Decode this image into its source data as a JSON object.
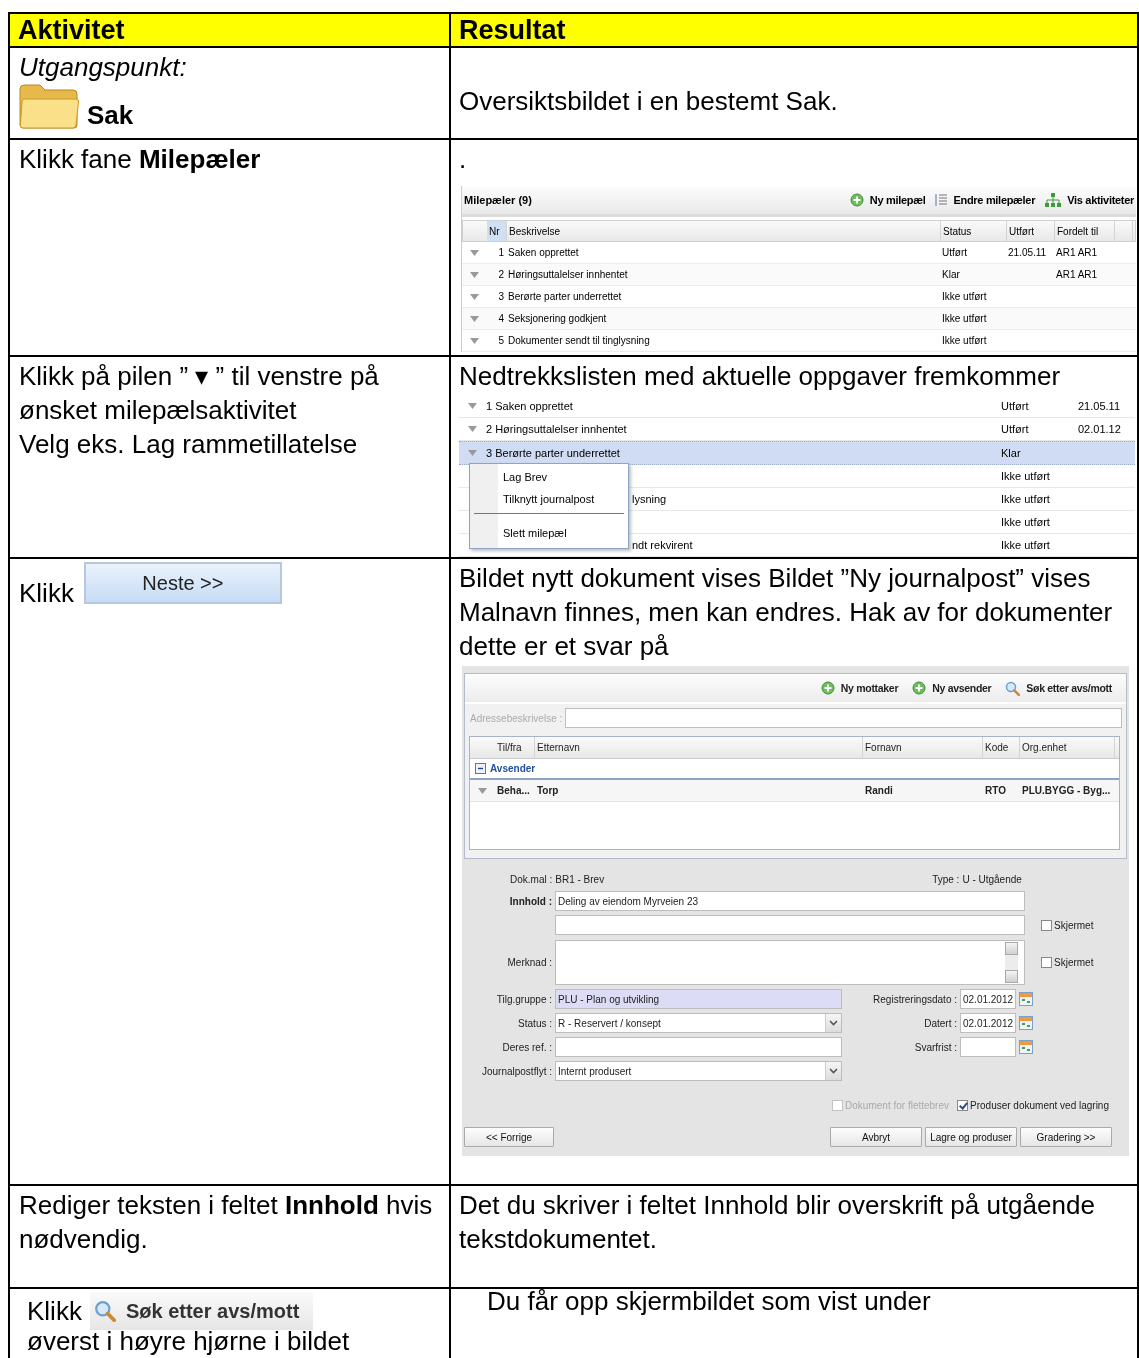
{
  "table": {
    "columns": [
      {
        "label": "Aktivitet"
      },
      {
        "label": "Resultat"
      }
    ],
    "rows": [
      {
        "activity": [
          {
            "kind": "caption",
            "text": "Utgangspunkt:"
          },
          {
            "kind": "folder",
            "label": "Sak"
          }
        ],
        "result": [
          {
            "kind": "text",
            "text": "Oversiktsbildet i en bestemt Sak."
          }
        ]
      },
      {
        "activity": [
          {
            "kind": "text",
            "text": "Klikk fane **Milepæler**"
          }
        ],
        "result": [
          {
            "kind": "text",
            "text": "."
          },
          {
            "kind": "milestones",
            "title": "Milepæler (9)",
            "actions": [
              {
                "label": "Ny milepæl"
              },
              {
                "label": "Endre milepæler"
              },
              {
                "label": "Vis aktiviteter"
              }
            ],
            "columns": [
              {
                "label": "Nr",
                "sorted": true
              },
              {
                "label": "Beskrivelse",
                "sorted": false
              },
              {
                "label": "Status",
                "sorted": false
              },
              {
                "label": "Utført",
                "sorted": false
              },
              {
                "label": "Fordelt til",
                "sorted": false
              }
            ],
            "rows": [
              {
                "nr": "1",
                "description": "Saken opprettet",
                "status": "Utført",
                "done": "21.05.11",
                "assigned": "AR1 AR1"
              },
              {
                "nr": "2",
                "description": "Høringsuttalelser innhentet",
                "status": "Klar",
                "assigned": "AR1 AR1"
              },
              {
                "nr": "3",
                "description": "Berørte parter underrettet",
                "status": "Ikke utført"
              },
              {
                "nr": "4",
                "description": "Seksjonering godkjent",
                "status": "Ikke utført"
              },
              {
                "nr": "5",
                "description": "Dokumenter sendt til tinglysning",
                "status": "Ikke utført"
              }
            ]
          }
        ]
      },
      {
        "activity": [
          {
            "kind": "text",
            "text": "Klikk på pilen ” ▾ ” til venstre på ønsket milepælsaktivitet"
          },
          {
            "kind": "text",
            "text": "Velg eks. Lag rammetillatelse"
          }
        ],
        "result": [
          {
            "kind": "text",
            "text": "Nedtrekkslisten med aktuelle oppgaver fremkommer"
          },
          {
            "kind": "dropdown",
            "rows": [
              {
                "kind": "full",
                "text": "1 Saken opprettet",
                "status": "Utført",
                "date": "21.05.11",
                "selected": false
              },
              {
                "kind": "full",
                "text": "2 Høringsuttalelser innhentet",
                "status": "Utført",
                "date": "02.01.12",
                "selected": false
              },
              {
                "kind": "full",
                "text": "3 Berørte parter underrettet",
                "status": "Klar",
                "selected": true
              },
              {
                "kind": "partial",
                "status": "Ikke utført",
                "selected": false
              },
              {
                "kind": "partial",
                "text": "lysning",
                "status": "Ikke utført",
                "selected": false
              },
              {
                "kind": "partial",
                "status": "Ikke utført",
                "selected": false
              },
              {
                "kind": "partial",
                "text": "ndt rekvirent",
                "status": "Ikke utført",
                "selected": false
              }
            ],
            "menu": [
              {
                "kind": "item",
                "label": "Lag Brev"
              },
              {
                "kind": "item",
                "label": "Tilknytt journalpost"
              },
              {
                "kind": "separator"
              },
              {
                "kind": "item",
                "label": "Slett milepæl"
              }
            ]
          }
        ]
      },
      {
        "activity": [
          {
            "kind": "click",
            "text": "Klikk",
            "button": {
              "kind": "next",
              "label": "Neste >>"
            }
          }
        ],
        "result": [
          {
            "kind": "text",
            "text": "Bildet nytt dokument vises Bildet ”Ny journalpost” vises"
          },
          {
            "kind": "text",
            "text": "Malnavn finnes, men kan endres. Hak av for dokumenter dette er et svar på"
          },
          {
            "kind": "journal",
            "actions": [
              {
                "label": "Ny mottaker"
              },
              {
                "label": "Ny avsender"
              },
              {
                "label": "Søk etter avs/mott"
              }
            ],
            "address": {
              "label": "Adressebeskrivelse :",
              "disabled": true
            },
            "grid": {
              "columns": [
                "Til/fra",
                "Etternavn",
                "Fornavn",
                "Kode",
                "Org.enhet"
              ],
              "rows": [
                {
                  "kind": "group",
                  "label": "Avsender",
                  "expanded": true
                },
                {
                  "kind": "data",
                  "cells": [
                    "Beha...",
                    "Torp",
                    "Randi",
                    "RTO",
                    "PLU.BYGG - Byg..."
                  ]
                }
              ]
            },
            "info": [
              {
                "label": "Dok.mal :",
                "value": "BR1 - Brev"
              },
              {
                "label": "Type :",
                "value": "U - Utgående"
              }
            ],
            "content": {
              "label": "Innhold :",
              "value": "Deling av eiendom Myrveien 23"
            },
            "extra": {
              "label": "Skjermet",
              "checked": false
            },
            "remark": {
              "label": "Merknad :",
              "screened": {
                "label": "Skjermet",
                "checked": false
              }
            },
            "left_fields": [
              {
                "kind": "text",
                "label": "Tilg.gruppe :",
                "value": "PLU - Plan og utvikling",
                "readonly": true
              },
              {
                "kind": "select",
                "label": "Status :",
                "value": "R - Reservert / konsept",
                "readonly": false
              },
              {
                "kind": "text",
                "label": "Deres ref. :",
                "readonly": false
              },
              {
                "kind": "select",
                "label": "Journalpostflyt :",
                "value": "Internt produsert",
                "readonly": false
              }
            ],
            "date_fields": [
              {
                "label": "Registreringsdato :",
                "value": "02.01.2012"
              },
              {
                "label": "Datert :",
                "value": "02.01.2012"
              },
              {
                "label": "Svarfrist :"
              }
            ],
            "options": [
              {
                "label": "Dokument for flettebrev",
                "checked": false,
                "disabled": true
              },
              {
                "label": "Produser dokument ved lagring",
                "checked": true,
                "disabled": false
              }
            ],
            "buttons": [
              {
                "kind": "left",
                "label": "<< Forrige"
              },
              {
                "kind": "right",
                "label": "Avbryt"
              },
              {
                "kind": "right",
                "label": "Lagre og produser"
              },
              {
                "kind": "right",
                "label": "Gradering >>"
              }
            ]
          }
        ]
      },
      {
        "activity": [
          {
            "kind": "text",
            "text": "Rediger teksten i feltet **Innhold** hvis nødvendig."
          }
        ],
        "result": [
          {
            "kind": "text",
            "text": "Det du skriver i feltet Innhold blir overskrift på utgående tekstdokumentet."
          }
        ]
      },
      {
        "activity": [
          {
            "kind": "click",
            "text": "Klikk",
            "button": {
              "kind": "search",
              "label": "Søk etter avs/mott"
            }
          },
          {
            "kind": "text",
            "text": "øverst i høyre hjørne i bildet"
          }
        ],
        "result": [
          {
            "kind": "indented",
            "text": "Du får opp skjermbildet som vist under"
          }
        ]
      }
    ]
  }
}
